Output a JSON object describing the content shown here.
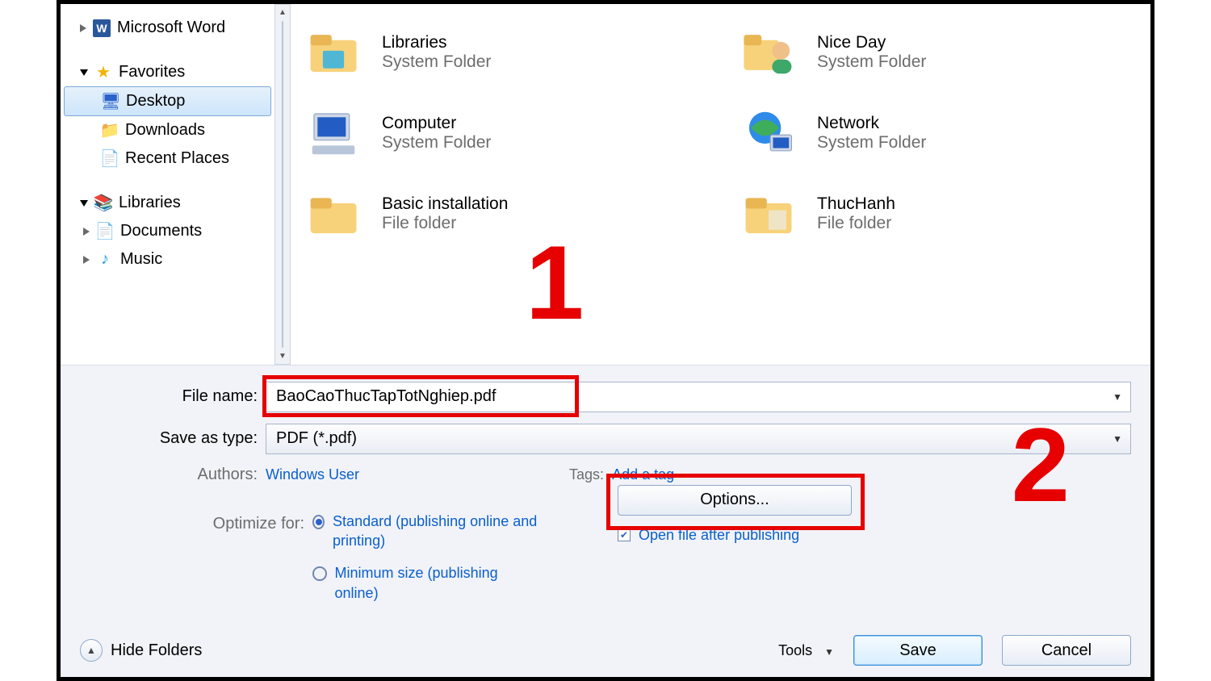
{
  "nav": {
    "word": "Microsoft Word",
    "favorites": "Favorites",
    "desktop": "Desktop",
    "downloads": "Downloads",
    "recent": "Recent Places",
    "libraries": "Libraries",
    "documents": "Documents",
    "music": "Music"
  },
  "grid": {
    "items": [
      {
        "name": "Libraries",
        "sub": "System Folder"
      },
      {
        "name": "Nice Day",
        "sub": "System Folder"
      },
      {
        "name": "Computer",
        "sub": "System Folder"
      },
      {
        "name": "Network",
        "sub": "System Folder"
      },
      {
        "name": "Basic installation",
        "sub": "File folder"
      },
      {
        "name": "ThucHanh",
        "sub": "File folder"
      }
    ]
  },
  "labels": {
    "filename": "File name:",
    "saveastype": "Save as type:",
    "authors": "Authors:",
    "tags": "Tags:",
    "optimize": "Optimize for:",
    "tools": "Tools",
    "hidefolders": "Hide Folders"
  },
  "values": {
    "filename": "BaoCaoThucTapTotNghiep.pdf",
    "saveastype": "PDF (*.pdf)",
    "authors": "Windows User",
    "tags_hint": "Add a tag",
    "opt_std": "Standard (publishing online and printing)",
    "opt_min": "Minimum size (publishing online)",
    "options_btn": "Options...",
    "open_after": "Open file after publishing",
    "save": "Save",
    "cancel": "Cancel"
  },
  "annotations": {
    "one": "1",
    "two": "2"
  }
}
